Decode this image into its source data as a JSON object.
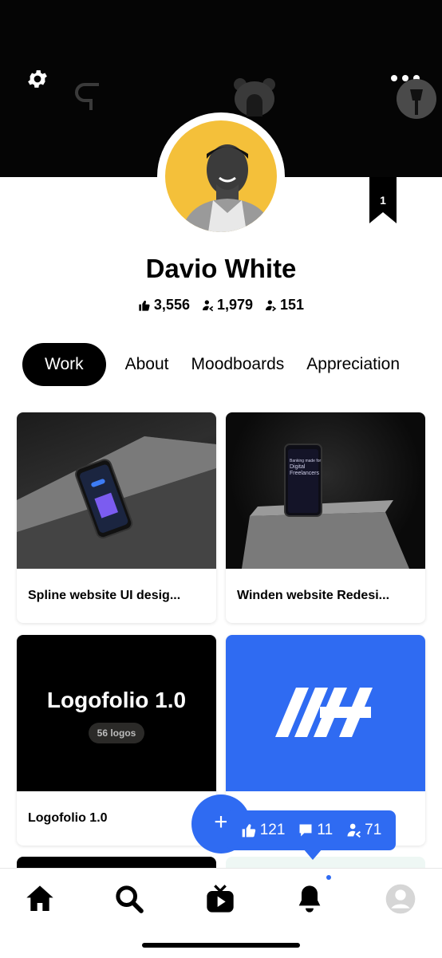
{
  "profile": {
    "name": "Davio White",
    "appreciations": "3,556",
    "followers": "1,979",
    "following": "151",
    "badge_count": "1"
  },
  "tabs": [
    {
      "label": "Work",
      "active": true
    },
    {
      "label": "About",
      "active": false
    },
    {
      "label": "Moodboards",
      "active": false
    },
    {
      "label": "Appreciation",
      "active": false
    }
  ],
  "projects": [
    {
      "title": "Spline website UI desig..."
    },
    {
      "title": "Winden website Redesi..."
    },
    {
      "title": "Logofolio 1.0",
      "thumb_title": "Logofolio 1.0",
      "thumb_sub": "56 logos"
    },
    {
      "title": ""
    }
  ],
  "phone_screen": {
    "heading_line1": "Banking made for",
    "heading_line2": "Digital",
    "heading_line3": "Freelancers"
  },
  "popover": {
    "likes": "121",
    "comments": "11",
    "followers": "71"
  },
  "fab_label": "+",
  "icons": {
    "settings": "gear-icon",
    "more": "more-dots-icon",
    "home": "home-icon",
    "search": "search-icon",
    "tv": "tv-icon",
    "notifications": "bell-icon",
    "profile": "user-avatar-icon"
  },
  "colors": {
    "accent": "#2f6bf2",
    "avatar_bg": "#f4c03a",
    "banner": "#050505"
  }
}
